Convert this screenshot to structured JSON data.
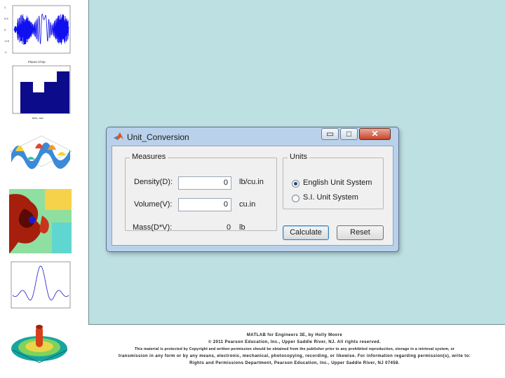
{
  "window": {
    "title": "Unit_Conversion",
    "controls": {
      "minimize": "▭",
      "maximize": "□",
      "close": "✕"
    }
  },
  "measures": {
    "legend": "Measures",
    "density_label": "Density(D):",
    "density_value": "0",
    "density_unit": "lb/cu.in",
    "volume_label": "Volume(V):",
    "volume_value": "0",
    "volume_unit": "cu.in",
    "mass_label": "Mass(D*V):",
    "mass_value": "0",
    "mass_unit": "lb"
  },
  "units": {
    "legend": "Units",
    "options": [
      {
        "label": "English Unit System",
        "selected": true
      },
      {
        "label": "S.I. Unit System",
        "selected": false
      }
    ]
  },
  "buttons": {
    "calculate": "Calculate",
    "reset": "Reset"
  },
  "footer": {
    "line1": "MATLAB for Engineers 3E, by Holly Moore",
    "line2": "© 2011 Pearson Education, Inc., Upper Saddle River, NJ. All rights reserved.",
    "line3": "This material is protected by Copyright and written permission should be obtained from the publisher prior to any prohibited reproduction, storage in a retrieval system, or",
    "line4": "transmission in any form or by any means, electronic, mechanical, photocopying, recording, or likewise. For information regarding permission(s), write to:",
    "line5": "Rights and Permissions Department, Pearson Education, Inc., Upper Saddle River, NJ 07458."
  },
  "thumbnails": {
    "plot1_title": "Planet Chirp",
    "plot1_ticks": [
      "1",
      "0.5",
      "0",
      "-0.5",
      "-1"
    ],
    "plot2_xlabel": "time, sec",
    "colors": {
      "accent": "#2222cc",
      "slide_bg": "#bde0e3",
      "window_frame": "#b9d1ea",
      "close": "#c7442a"
    }
  }
}
